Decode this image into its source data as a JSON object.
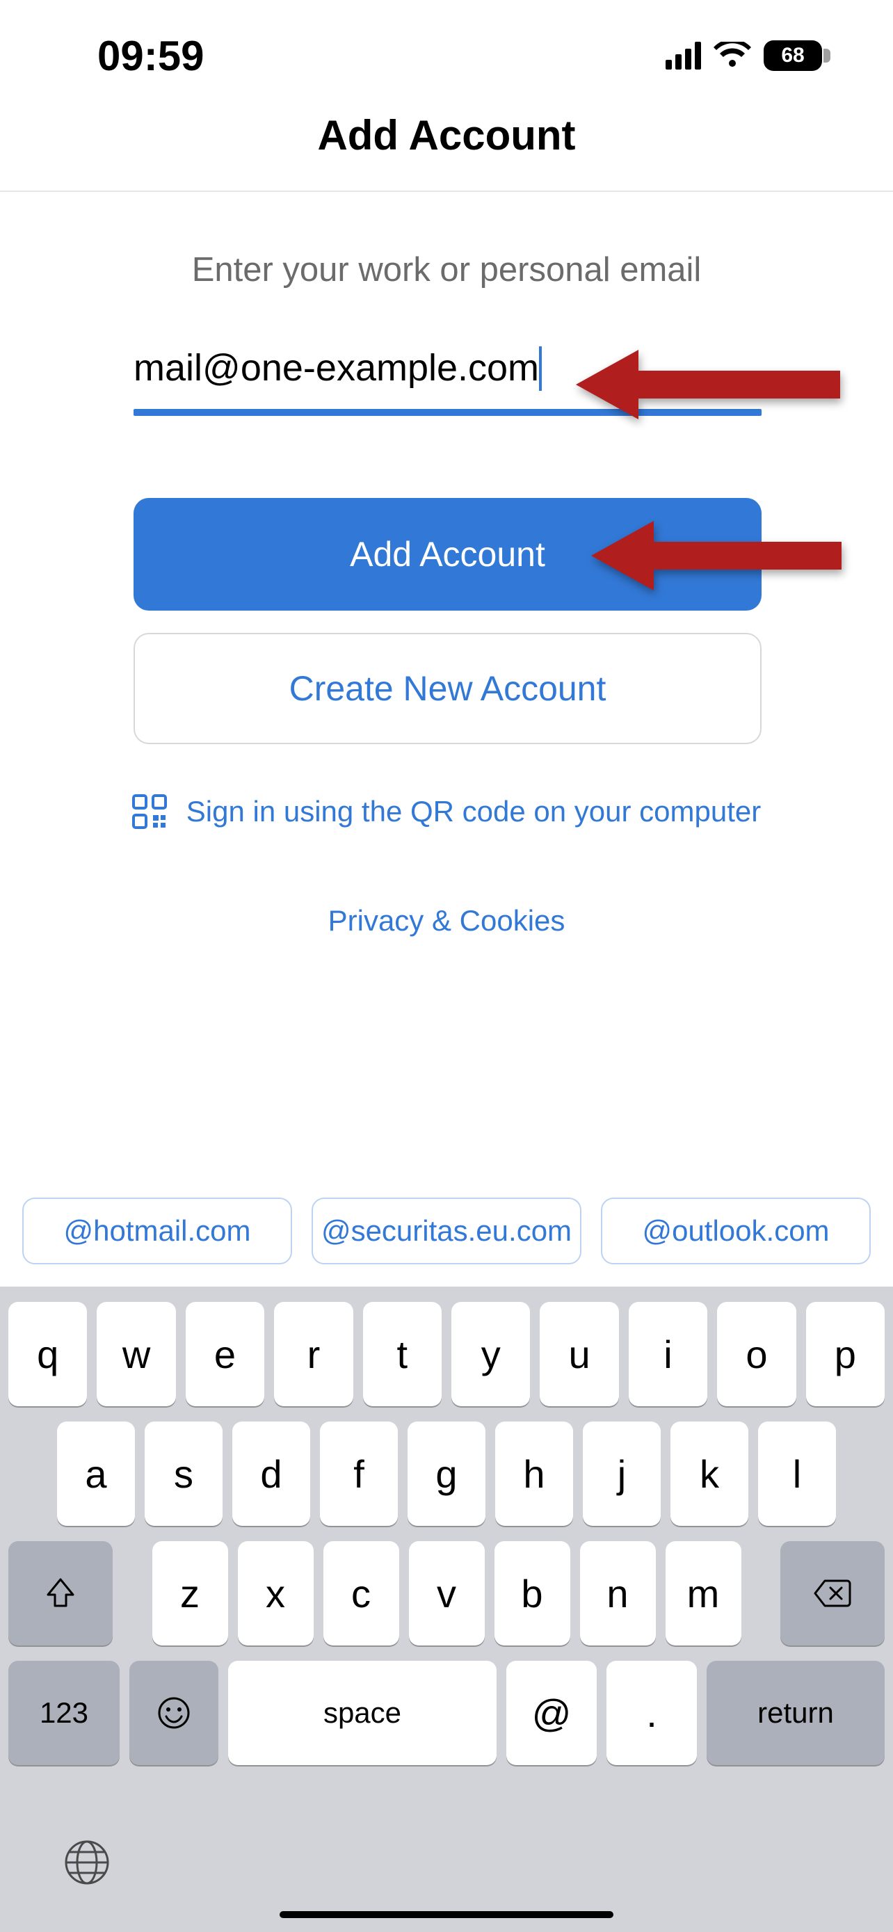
{
  "statusbar": {
    "time": "09:59",
    "battery_pct": "68"
  },
  "header": {
    "title": "Add Account"
  },
  "form": {
    "instruction": "Enter your work or personal email",
    "email_value": "mail@one-example.com",
    "add_button_label": "Add Account",
    "create_button_label": "Create New Account",
    "qr_label": "Sign in using the QR code on your computer",
    "privacy_label": "Privacy & Cookies"
  },
  "suggestions": {
    "s0": "@hotmail.com",
    "s1": "@securitas.eu.com",
    "s2": "@outlook.com"
  },
  "keyboard": {
    "r1": {
      "k0": "q",
      "k1": "w",
      "k2": "e",
      "k3": "r",
      "k4": "t",
      "k5": "y",
      "k6": "u",
      "k7": "i",
      "k8": "o",
      "k9": "p"
    },
    "r2": {
      "k0": "a",
      "k1": "s",
      "k2": "d",
      "k3": "f",
      "k4": "g",
      "k5": "h",
      "k6": "j",
      "k7": "k",
      "k8": "l"
    },
    "r3": {
      "k0": "z",
      "k1": "x",
      "k2": "c",
      "k3": "v",
      "k4": "b",
      "k5": "n",
      "k6": "m"
    },
    "mode": "123",
    "space": "space",
    "at": "@",
    "dot": ".",
    "ret": "return"
  },
  "colors": {
    "accent": "#3278d6",
    "arrow": "#b01e1e"
  }
}
